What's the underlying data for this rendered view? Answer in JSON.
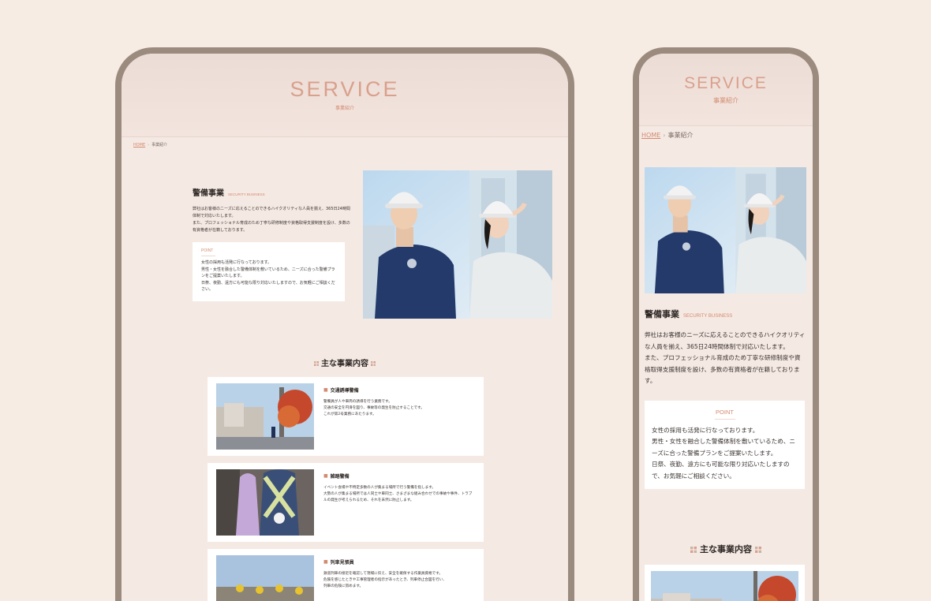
{
  "tablet": {
    "hero": {
      "title": "SERVICE",
      "subtitle": "事業紹介"
    },
    "breadcrumb": {
      "home": "HOME",
      "sep": "›",
      "current": "事業紹介"
    },
    "intro": {
      "title": "警備事業",
      "title_en": "SECURITY BUSINESS",
      "desc1": "弊社はお客様のニーズに応えることのできるハイクオリティな人員を揃え、365日24時間体制で対応いたします。",
      "desc2": "また、プロフェッショナル育成のため丁寧な研修制度や資格取得支援制度を設け、多数の有資格者が在籍しております。"
    },
    "point": {
      "label": "POINT",
      "line1": "女性の採用も活発に行なっております。",
      "line2": "男性・女性を融合した警備体制を敷いているため、ニーズに合った警備プランをご提案いたします。",
      "line3": "日祭、夜勤、遠方にも可能な限り対応いたしますので、お気軽にご相談ください。"
    },
    "services_heading": "主な事業内容",
    "services": [
      {
        "name": "交通誘導警備",
        "text1": "警備員が人や車両の誘導を行う業務です。",
        "text2": "交通の安全を円滑を図り、事故等の発生を防止することです。",
        "text3": "これが第2号業務にあたります。"
      },
      {
        "name": "雑踏警備",
        "text1": "イベント会場や不特定多数の人が集まる場所で行う警備を指します。",
        "text2": "大勢の人が集まる場所では人同士や車同士、さまざまな組み合わせでの事故や事件、トラブルの発生が考えられるため、それを未然に防止します。",
        "text3": ""
      },
      {
        "name": "列車見張員",
        "text1": "鉄道列車の接近を確認して現場に伝え、安全を確保する作業員資格です。",
        "text2": "危険を感じたときや工事管理者の指示があったとき、列車停止合図を行い、",
        "text3": "列車の危険に努めます。"
      }
    ]
  },
  "phone": {
    "hero": {
      "title": "SERVICE",
      "subtitle": "事業紹介"
    },
    "breadcrumb": {
      "home": "HOME",
      "sep": "›",
      "current": "事業紹介"
    },
    "intro": {
      "title": "警備事業",
      "title_en": "SECURITY BUSINESS",
      "desc1": "弊社はお客様のニーズに応えることのできるハイクオリティな人員を揃え、365日24時間体制で対応いたします。",
      "desc2": "また、プロフェッショナル育成のため丁寧な研修制度や資格取得支援制度を設け、多数の有資格者が在籍しております。"
    },
    "point": {
      "label": "POINT",
      "line1": "女性の採用も活発に行なっております。",
      "line2": "男性・女性を融合した警備体制を敷いているため、ニーズに合った警備プランをご提案いたします。",
      "line3": "日祭、夜勤、遠方にも可能な限り対応いたしますので、お気軽にご相談ください。"
    },
    "services_heading": "主な事業内容"
  },
  "colors": {
    "accent": "#d38a6f",
    "frame": "#9b8b7e",
    "page_bg": "#f7ece3"
  }
}
